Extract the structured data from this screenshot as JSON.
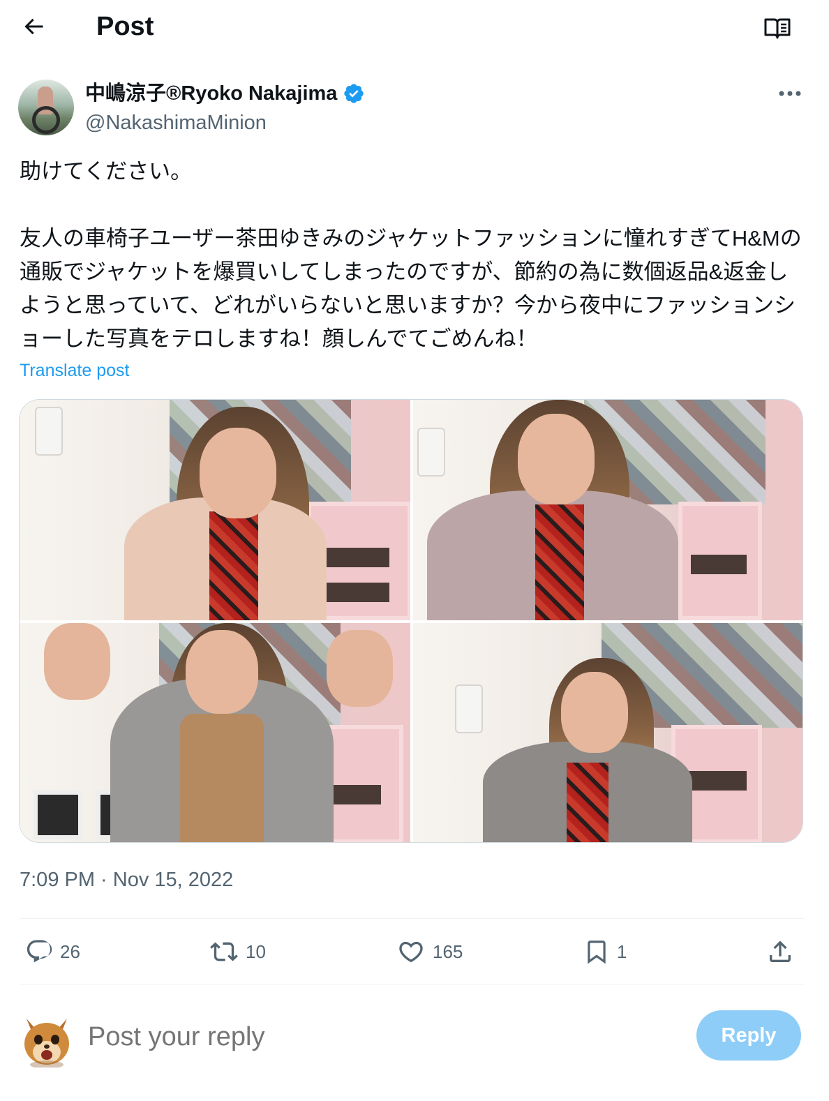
{
  "header": {
    "title": "Post",
    "back_icon": "arrow-left-icon",
    "reader_icon": "reader-mode-icon"
  },
  "author": {
    "name": "中嶋涼子®Ryoko Nakajima",
    "handle": "@NakashimaMinion",
    "verified": true,
    "verified_color": "#1d9bf0"
  },
  "post": {
    "text": "助けてください。\n\n友人の車椅子ユーザー茶田ゆきみのジャケットファッションに憧れすぎてH&Mの通販でジャケットを爆買いしてしまったのですが、節約の為に数個返品&返金しようと思っていて、どれがいらないと思いますか？今から夜中にファッションショーした写真をテロしますね！顔しんでてごめんね！",
    "translate_label": "Translate post",
    "photos": [
      {
        "jacket": "beige blazer"
      },
      {
        "jacket": "mauve blazer"
      },
      {
        "jacket": "grey tweed coat"
      },
      {
        "jacket": "grey houndstooth coat"
      }
    ],
    "timestamp": "7:09 PM · Nov 15, 2022"
  },
  "actions": {
    "replies": "26",
    "reposts": "10",
    "likes": "165",
    "bookmarks": "1"
  },
  "composer": {
    "placeholder": "Post your reply",
    "reply_label": "Reply",
    "reply_button_color": "#8ecdf8"
  },
  "colors": {
    "accent": "#1d9bf0",
    "secondary_text": "#536471",
    "divider": "#eff3f4"
  }
}
